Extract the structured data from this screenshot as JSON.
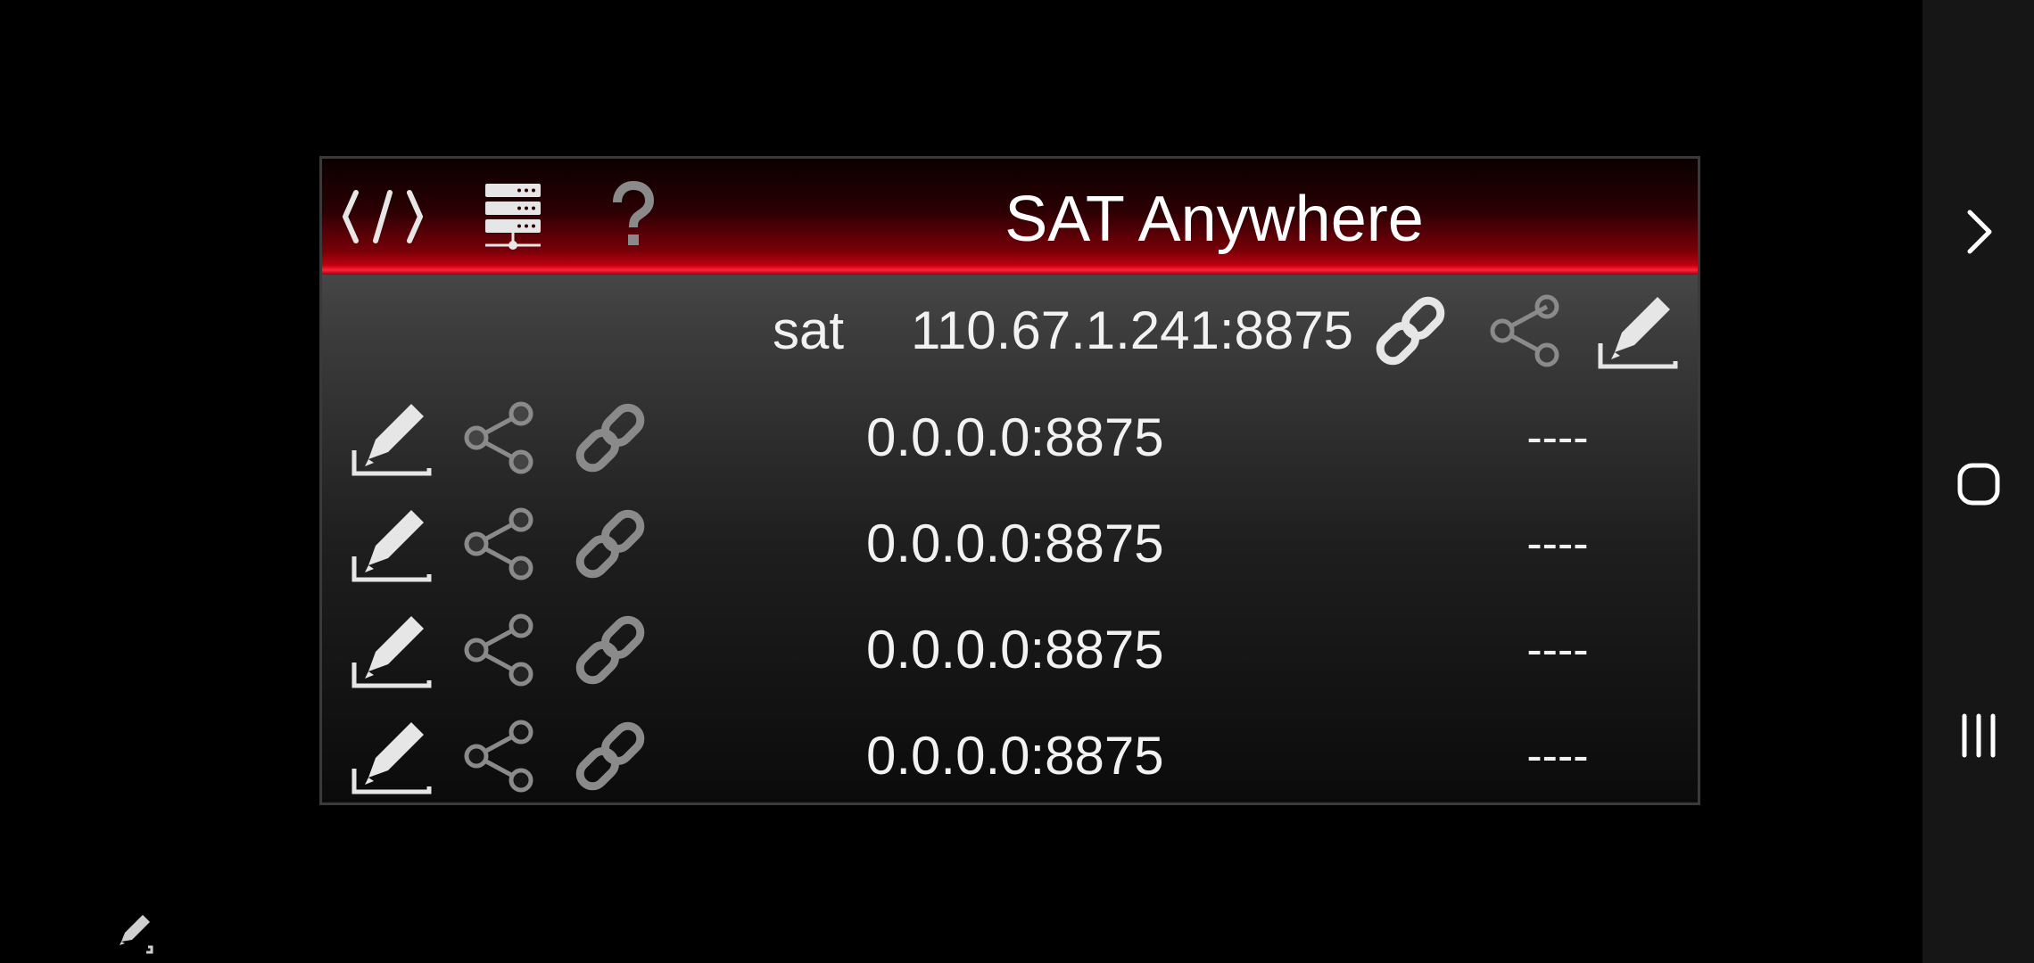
{
  "app": {
    "title": "SAT Anywhere"
  },
  "toolbar": {
    "icons": [
      "code-icon",
      "server-icon",
      "help-icon"
    ]
  },
  "active_entry": {
    "name": "sat",
    "address": "110.67.1.241:8875",
    "icons": [
      "link-icon",
      "share-icon",
      "edit-icon"
    ]
  },
  "entries": [
    {
      "address": "0.0.0.0:8875",
      "status": "----"
    },
    {
      "address": "0.0.0.0:8875",
      "status": "----"
    },
    {
      "address": "0.0.0.0:8875",
      "status": "----"
    },
    {
      "address": "0.0.0.0:8875",
      "status": "----"
    }
  ],
  "navigation": {
    "buttons": [
      "chevron-right-icon",
      "home-icon",
      "recents-icon"
    ]
  },
  "colors": {
    "accent": "#e0001a",
    "text": "#f2f2f2",
    "icon_active": "#e6e6e6",
    "icon_dim": "#8a8a8a"
  }
}
